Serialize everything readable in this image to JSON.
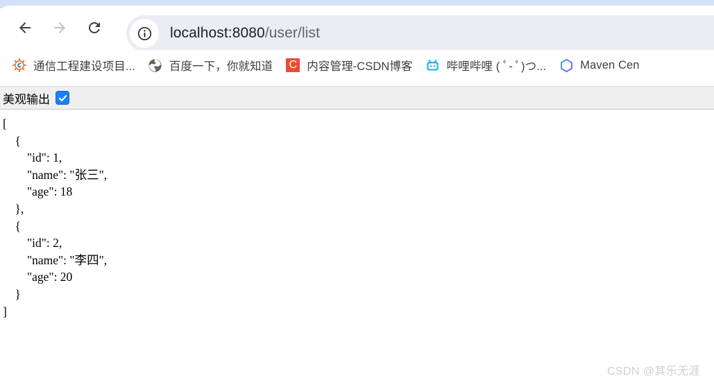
{
  "window": {
    "title": "localhost:8080/user/list"
  },
  "toolbar": {
    "back_tooltip": "Back",
    "forward_tooltip": "Forward",
    "reload_tooltip": "Reload",
    "site_info_tooltip": "View site information",
    "url_host": "localhost:8080",
    "url_path": "/user/list"
  },
  "bookmarks": [
    {
      "label": "通信工程建设项目...",
      "icon": "sunburst-e-favicon"
    },
    {
      "label": "百度一下，你就知道",
      "icon": "globe-favicon"
    },
    {
      "label": "内容管理-CSDN博客",
      "icon": "csdn-favicon",
      "icon_letter": "C"
    },
    {
      "label": "哔哩哔哩 ( ﾟ- ﾟ)つ...",
      "icon": "bilibili-tv-favicon"
    },
    {
      "label": "Maven Cen",
      "icon": "maven-hexagon-favicon"
    }
  ],
  "pretty_print": {
    "label": "美观输出",
    "checked": true
  },
  "json_viewer": {
    "content": "[\n    {\n        \"id\": 1,\n        \"name\": \"张三\",\n        \"age\": 18\n    },\n    {\n        \"id\": 2,\n        \"name\": \"李四\",\n        \"age\": 20\n    }\n]",
    "records": [
      {
        "id": 1,
        "name": "张三",
        "age": 18
      },
      {
        "id": 2,
        "name": "李四",
        "age": 20
      }
    ]
  },
  "watermark": {
    "text": "CSDN @其乐无涯"
  },
  "colors": {
    "tab_strip": "#d3e2fb",
    "omnibox": "#eaedf4",
    "pretty_bar": "#efefef",
    "checkbox_blue": "#1b7ff7",
    "csdn_red": "#eb4c36",
    "bilibili_blue": "#25b3e8",
    "watermark_gray": "#cfcfcf"
  }
}
